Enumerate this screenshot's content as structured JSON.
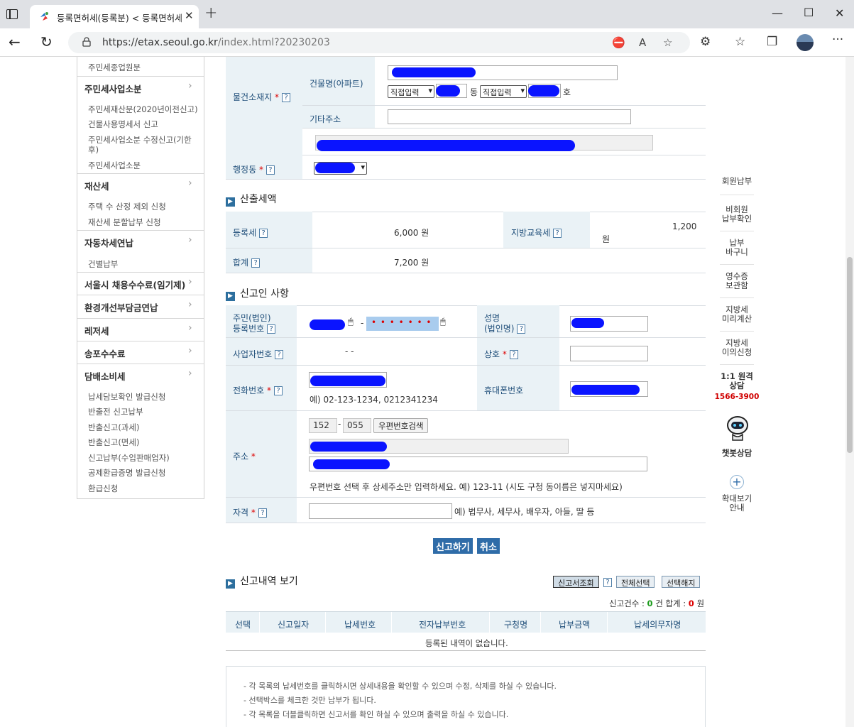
{
  "browser": {
    "tab_title": "등록면허세(등록분) < 등록면허세",
    "url_host": "https://etax.seoul.go.kr",
    "url_path": "/index.html?20230203"
  },
  "sidebar": {
    "top_item": "주민세종업원분",
    "groups": [
      {
        "label": "주민세사업소분",
        "children": [
          "주민세재산분(2020년이전신고)",
          "건물사용명세서 신고",
          "주민세사업소분 수정신고(기한",
          "후)",
          "주민세사업소분"
        ]
      },
      {
        "label": "재산세",
        "children": [
          "주택 수 산정 제외 신청",
          "재산세 분할납부 신청"
        ]
      },
      {
        "label": "자동차세연납",
        "children": [
          "건별납부"
        ]
      },
      {
        "label": "서울시 채용수수료(임기제)",
        "children": []
      },
      {
        "label": "환경개선부담금연납",
        "children": []
      },
      {
        "label": "레저세",
        "children": []
      },
      {
        "label": "송포수수료",
        "children": []
      },
      {
        "label": "담배소비세",
        "children": [
          "납세담보확인 발급신청",
          "반출전 신고납부",
          "반출신고(과세)",
          "반출신고(면세)",
          "신고납부(수입판매업자)",
          "공제환급증명 발급신청",
          "환급신청"
        ]
      }
    ]
  },
  "property": {
    "location_label": "물건소재지",
    "building_label": "건물명(아파트)",
    "direct_input_1": "직접입력",
    "dong_suffix": "동",
    "direct_input_2": "직접입력",
    "ho_suffix": "호",
    "other_addr_label": "기타주소",
    "admin_dong_label": "행정동"
  },
  "tax": {
    "section_title": "산출세액",
    "registration_tax_label": "등록세",
    "registration_tax_value": "6,000",
    "won": "원",
    "edu_tax_label": "지방교육세",
    "edu_tax_value": "1,200",
    "total_label": "합계",
    "total_value": "7,200"
  },
  "filer": {
    "section_title": "신고인 사항",
    "rrn_label_1": "주민(법인)",
    "rrn_label_2": "등록번호",
    "rrn_dash": "-",
    "rrn_masked": "• • • • • • •",
    "name_label_1": "성명",
    "name_label_2": "(법인명)",
    "biz_no_label": "사업자번호",
    "biz_dashes": "-            -",
    "trade_name_label": "상호",
    "phone_label": "전화번호",
    "phone_hint": "예) 02-123-1234, 0212341234",
    "mobile_label": "휴대폰번호",
    "address_label": "주소",
    "zip1": "152",
    "zip_dash": "-",
    "zip2": "055",
    "zip_search": "우편번호검색",
    "address_hint": "우편번호 선택 후 상세주소만 입력하세요. 예) 123-11 (시도 구청 동이름은 넣지마세요)",
    "qualification_label": "자격",
    "qualification_hint": "예) 법무사, 세무사, 배우자, 아들, 딸 등"
  },
  "actions": {
    "submit": "신고하기",
    "cancel": "취소"
  },
  "history": {
    "section_title": "신고내역 보기",
    "view_btn": "신고서조회",
    "select_all": "전체선택",
    "deselect": "선택해지",
    "count_prefix": "신고건수 :",
    "count_value": "0",
    "count_unit": "건 합계 :",
    "sum_value": "0",
    "sum_unit": "원",
    "columns": [
      "선택",
      "신고일자",
      "납세번호",
      "전자납부번호",
      "구청명",
      "납부금액",
      "납세의무자명"
    ],
    "empty_text": "등록된 내역이 없습니다.",
    "notes": [
      "- 각 목록의 납세번호를 클릭하시면 상세내용을 확인할 수 있으며 수정, 삭제를 하실 수 있습니다.",
      "- 선택박스를 체크한 것만 납부가 됩니다.",
      "- 각 목록을 더블클릭하면 신고서를 확인 하실 수 있으며 출력을 하실 수 있습니다."
    ]
  },
  "right_menu": {
    "member_pay": "회원납부",
    "nonmember_1": "비회원",
    "nonmember_2": "납부확인",
    "cart_1": "납부",
    "cart_2": "바구니",
    "receipt_1": "영수증",
    "receipt_2": "보관함",
    "precalc_1": "지방세",
    "precalc_2": "미리계산",
    "objection_1": "지방세",
    "objection_2": "이의신청",
    "consult_1": "1:1 원격",
    "consult_2": "상담",
    "phone": "1566-3900",
    "chatbot": "챗봇상담",
    "zoom_1": "확대보기",
    "zoom_2": "안내"
  },
  "colors": {
    "accent": "#2f6ca8",
    "header_bg": "#eaf2f6",
    "redaction": "#0a14ff",
    "phone_red": "#d00000"
  }
}
